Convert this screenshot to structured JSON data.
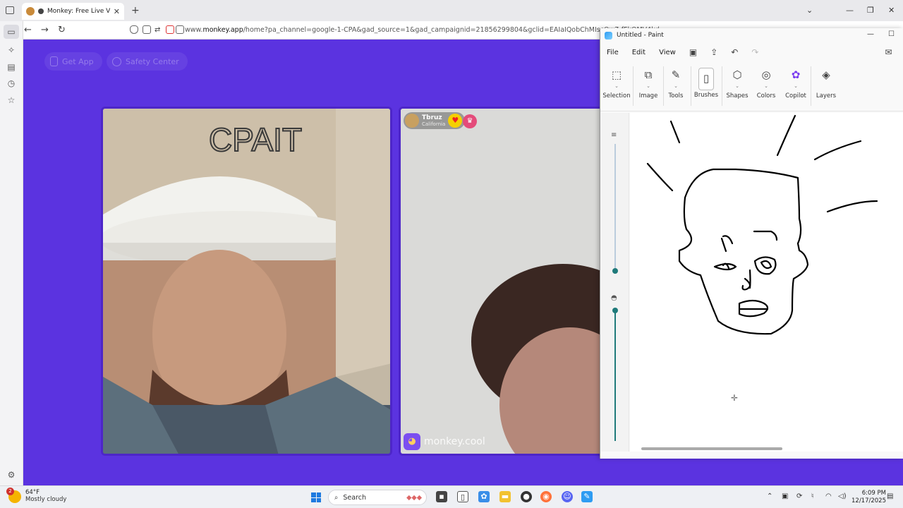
{
  "browser": {
    "tab_title": "Monkey: Free Live Video Ch",
    "url_prefix": "www.",
    "url_domain": "monkey.app",
    "url_rest": "/home?pa_channel=google-1-CPA&gad_source=1&gad_campaignid=21856299804&gclid=EAIaIQobChMIscOw7-fFkQMV4kd",
    "icons": [
      "tab-list-icon",
      "new-tab-icon",
      "back-icon",
      "forward-icon",
      "reload-icon",
      "shield-icon",
      "lock-icon",
      "permissions-icon",
      "camera-icon",
      "picture-in-picture-icon"
    ]
  },
  "page": {
    "get_app": "Get App",
    "safety_center": "Safety Center",
    "peer_name": "Tbruz",
    "peer_location": "California",
    "brand": "monkey.cool"
  },
  "paint": {
    "title": "Untitled - Paint",
    "menu": [
      "File",
      "Edit",
      "View"
    ],
    "tools": [
      "Selection",
      "Image",
      "Tools",
      "Brushes",
      "Shapes",
      "Colors",
      "Copilot",
      "Layers"
    ]
  },
  "taskbar": {
    "temperature": "64°F",
    "weather": "Mostly cloudy",
    "weather_badge": "2",
    "search_placeholder": "Search",
    "time": "6:09 PM",
    "date": "12/17/2025"
  }
}
